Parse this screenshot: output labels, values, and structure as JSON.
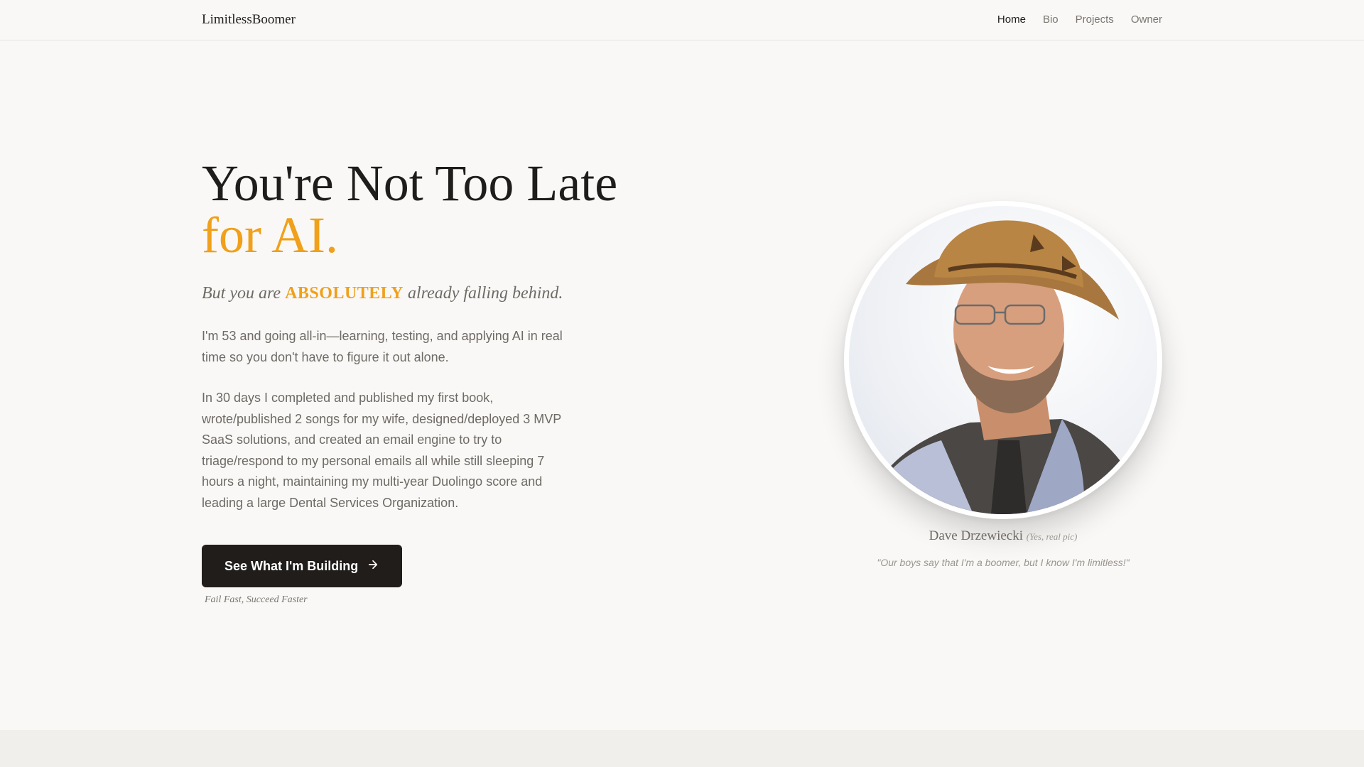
{
  "nav": {
    "brand": "LimitlessBoomer",
    "links": [
      {
        "label": "Home",
        "active": true
      },
      {
        "label": "Bio",
        "active": false
      },
      {
        "label": "Projects",
        "active": false
      },
      {
        "label": "Owner",
        "active": false
      }
    ]
  },
  "hero": {
    "headline_line1": "You're Not Too Late",
    "headline_line2": "for AI.",
    "tagline_pre": "But you are ",
    "tagline_emphasis": "ABSOLUTELY",
    "tagline_post": " already falling behind.",
    "paragraph1": "I'm 53 and going all-in—learning, testing, and applying AI in real time so you don't have to figure it out alone.",
    "paragraph2": "In 30 days I completed and published my first book, wrote/published 2 songs for my wife, designed/deployed 3 MVP SaaS solutions, and created an email engine to try to triage/respond to my personal emails all while still sleeping 7 hours a night, maintaining my multi-year Duolingo score and leading a large Dental Services Organization.",
    "cta_label": "See What I'm Building",
    "cta_icon": "arrow-right-icon",
    "cta_caption": "Fail Fast, Succeed Faster"
  },
  "profile": {
    "name": "Dave Drzewiecki",
    "name_note": "(Yes, real pic)",
    "quote": "\"Our boys say that I'm a boomer, but I know I'm limitless!\""
  },
  "colors": {
    "accent": "#f0a01a",
    "background": "#f9f8f6",
    "button": "#201d1b",
    "text_muted": "#6e6a66"
  }
}
